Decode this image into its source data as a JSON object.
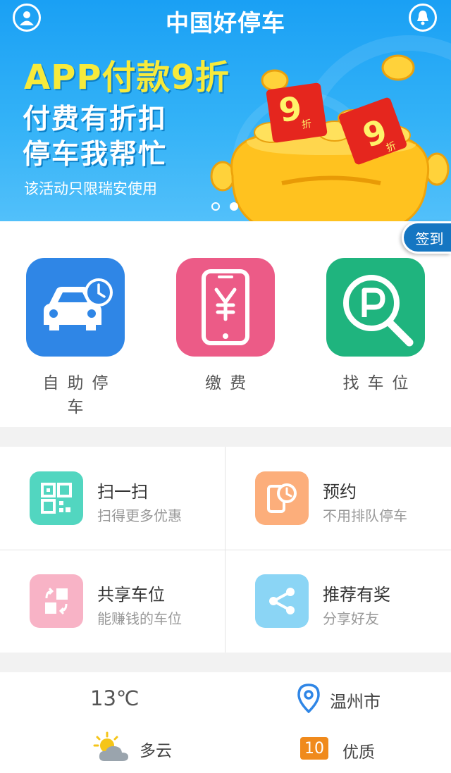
{
  "header": {
    "title": "中国好停车",
    "profile_icon": "user-icon",
    "notification_icon": "bell-icon"
  },
  "banner": {
    "headline": "APP付款9折",
    "line1": "付费有折扣",
    "line2": "停车我帮忙",
    "note": "该活动只限瑞安使用",
    "coupon_value": "9",
    "coupon_unit": "折",
    "slides": 2,
    "active_slide": 2
  },
  "signin": {
    "label": "签到"
  },
  "main_actions": [
    {
      "label": "自助停车",
      "icon": "car-clock-icon",
      "color": "#2f86e6"
    },
    {
      "label": "缴费",
      "icon": "phone-yen-icon",
      "color": "#ec5b87"
    },
    {
      "label": "找车位",
      "icon": "parking-search-icon",
      "color": "#1fb47e"
    }
  ],
  "features": [
    {
      "title": "扫一扫",
      "subtitle": "扫得更多优惠",
      "icon": "qr-scan-icon",
      "color": "#52d6c0"
    },
    {
      "title": "预约",
      "subtitle": "不用排队停车",
      "icon": "phone-clock-icon",
      "color": "#fcae7b"
    },
    {
      "title": "共享车位",
      "subtitle": "能赚钱的车位",
      "icon": "share-swap-icon",
      "color": "#f8b3c6"
    },
    {
      "title": "推荐有奖",
      "subtitle": "分享好友",
      "icon": "share-icon",
      "color": "#8bd5f5"
    }
  ],
  "weather": {
    "temperature": "13℃",
    "city": "温州市",
    "condition": "多云",
    "aqi_value": "10",
    "aqi_label": "优质",
    "location_icon": "location-pin-icon",
    "weather_icon": "partly-cloudy-icon"
  },
  "colors": {
    "banner_blue": "#1aa0f4",
    "headline_yellow": "#f7ea3b",
    "signin_blue": "#1576c2",
    "aqi_orange": "#f08a1c",
    "pin_blue": "#2f86e6"
  }
}
